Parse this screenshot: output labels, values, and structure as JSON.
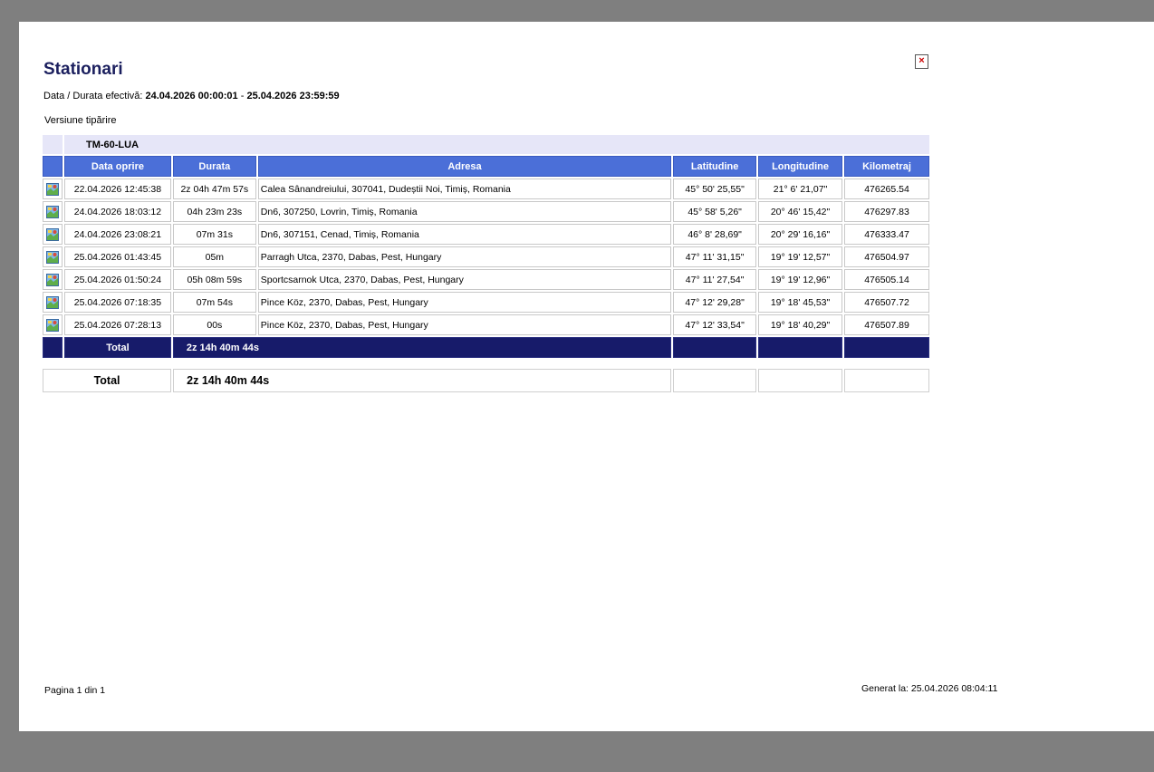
{
  "report": {
    "title": "Stationari",
    "close_glyph": "×",
    "period_label": "Data / Durata efectivă:",
    "period_start": "24.04.2026 00:00:01",
    "period_separator": "-",
    "period_end": "25.04.2026 23:59:59",
    "print_version_label": "Versiune tipărire"
  },
  "vehicle": {
    "plate": "TM-60-LUA"
  },
  "columns": {
    "stop_date": "Data oprire",
    "duration": "Durata",
    "address": "Adresa",
    "latitude": "Latitudine",
    "longitude": "Longitudine",
    "mileage": "Kilometraj"
  },
  "rows": [
    {
      "date": "22.04.2026 12:45:38",
      "duration": "2z 04h 47m 57s",
      "address": "Calea Sânandreiului,  307041, Dudeștii Noi, Timiș, Romania",
      "lat": "45° 50' 25,55\"",
      "lon": "21° 6' 21,07\"",
      "km": "476265.54"
    },
    {
      "date": "24.04.2026 18:03:12",
      "duration": "04h 23m 23s",
      "address": "Dn6,  307250, Lovrin, Timiș, Romania",
      "lat": "45° 58' 5,26\"",
      "lon": "20° 46' 15,42\"",
      "km": "476297.83"
    },
    {
      "date": "24.04.2026 23:08:21",
      "duration": "07m 31s",
      "address": "Dn6,  307151, Cenad, Timiș, Romania",
      "lat": "46° 8' 28,69\"",
      "lon": "20° 29' 16,16\"",
      "km": "476333.47"
    },
    {
      "date": "25.04.2026 01:43:45",
      "duration": "05m",
      "address": "Parragh Utca,  2370, Dabas, Pest, Hungary",
      "lat": "47° 11' 31,15\"",
      "lon": "19° 19' 12,57\"",
      "km": "476504.97"
    },
    {
      "date": "25.04.2026 01:50:24",
      "duration": "05h 08m 59s",
      "address": "Sportcsarnok Utca,  2370, Dabas, Pest, Hungary",
      "lat": "47° 11' 27,54\"",
      "lon": "19° 19' 12,96\"",
      "km": "476505.14"
    },
    {
      "date": "25.04.2026 07:18:35",
      "duration": "07m 54s",
      "address": "Pince Köz,  2370, Dabas, Pest, Hungary",
      "lat": "47° 12' 29,28\"",
      "lon": "19° 18' 45,53\"",
      "km": "476507.72"
    },
    {
      "date": "25.04.2026 07:28:13",
      "duration": "00s",
      "address": "Pince Köz,  2370, Dabas, Pest, Hungary",
      "lat": "47° 12' 33,54\"",
      "lon": "19° 18' 40,29\"",
      "km": "476507.89"
    }
  ],
  "vehicle_total": {
    "label": "Total",
    "duration": "2z 14h 40m 44s"
  },
  "grand_total": {
    "label": "Total",
    "duration": "2z 14h 40m 44s"
  },
  "footer": {
    "page_info": "Pagina 1 din 1",
    "generated": "Generat la: 25.04.2026 08:04:11"
  },
  "icons": {
    "row_icon": "map-icon"
  },
  "colors": {
    "title": "#1b1f5e",
    "header_bg": "#4b6fd8",
    "vehicle_bg": "#e6e6f8",
    "total_bg": "#171b6a"
  }
}
